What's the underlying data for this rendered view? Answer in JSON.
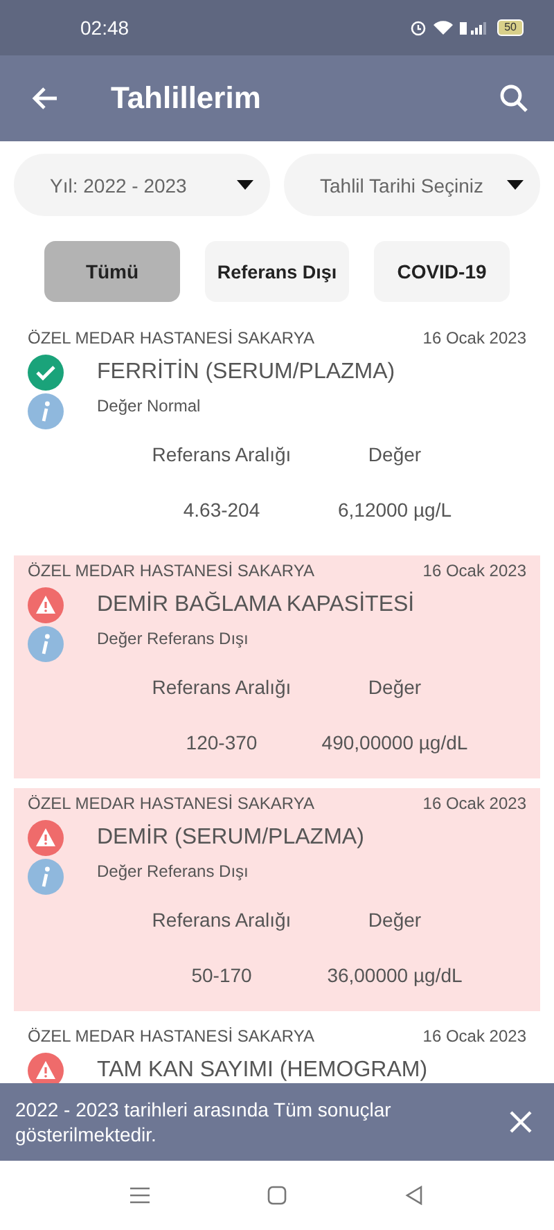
{
  "status_bar": {
    "time": "02:48",
    "battery": "50"
  },
  "app_bar": {
    "title": "Tahlillerim"
  },
  "filters": [
    {
      "value": "Yıl: 2022 - 2023"
    },
    {
      "value": "Tahlil Tarihi Seçiniz"
    }
  ],
  "chips": [
    {
      "label": "Tümü",
      "selected": true
    },
    {
      "label": "Referans Dışı",
      "selected": false
    },
    {
      "label": "COVID-19",
      "selected": false
    }
  ],
  "results": [
    {
      "hospital": "ÖZEL MEDAR HASTANESİ SAKARYA",
      "date": "16 Ocak 2023",
      "test": "FERRİTİN (SERUM/PLAZMA)",
      "out_of_range": false,
      "note": "Değer Normal",
      "range_label": "Referans Aralığı",
      "value_label": "Değer",
      "range": "4.63-204",
      "value": "6,12000 µg/L"
    },
    {
      "hospital": "ÖZEL MEDAR HASTANESİ SAKARYA",
      "date": "16 Ocak 2023",
      "test": "DEMİR BAĞLAMA KAPASİTESİ",
      "out_of_range": true,
      "note": "Değer Referans Dışı",
      "range_label": "Referans Aralığı",
      "value_label": "Değer",
      "range": "120-370",
      "value": "490,00000 µg/dL"
    },
    {
      "hospital": "ÖZEL MEDAR HASTANESİ SAKARYA",
      "date": "16 Ocak 2023",
      "test": "DEMİR (SERUM/PLAZMA)",
      "out_of_range": true,
      "note": "Değer Referans Dışı",
      "range_label": "Referans Aralığı",
      "value_label": "Değer",
      "range": "50-170",
      "value": "36,00000 µg/dL"
    },
    {
      "hospital": "ÖZEL MEDAR HASTANESİ SAKARYA",
      "date": "16 Ocak 2023",
      "test": "TAM KAN SAYIMI (HEMOGRAM)",
      "out_of_range": true,
      "highlighted": false
    }
  ],
  "snackbar": {
    "message": "2022 - 2023 tarihleri arasında Tüm sonuçlar gösterilmektedir."
  }
}
